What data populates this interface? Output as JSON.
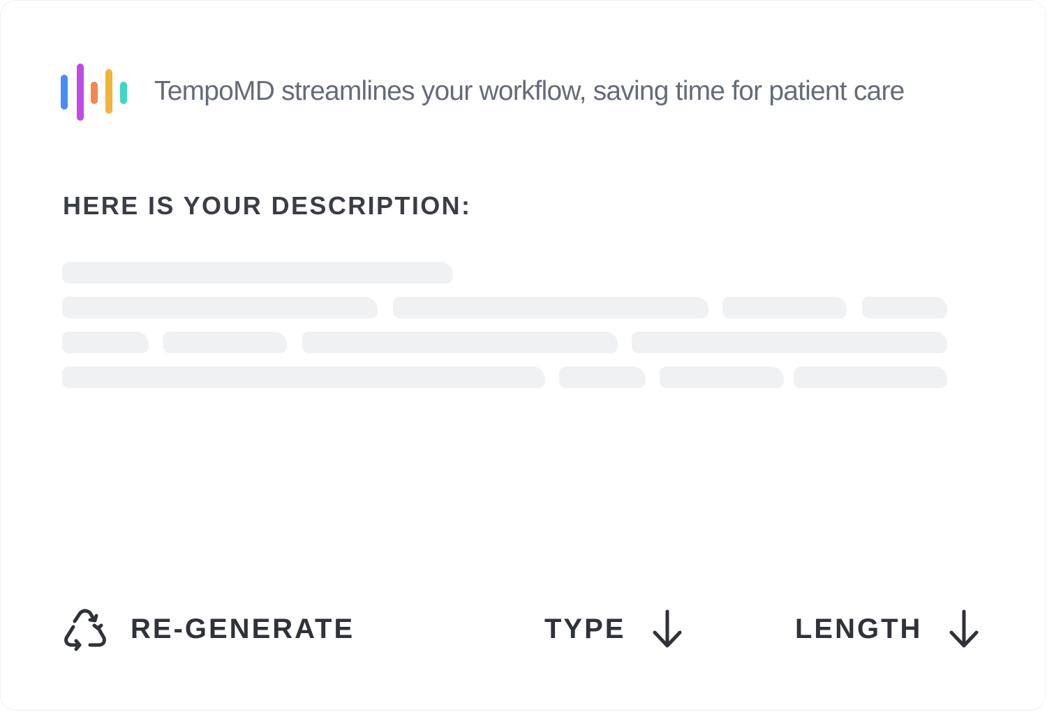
{
  "header": {
    "logo_icon": "sound-wave-logo-icon",
    "logo_colors": [
      "#4a8cf2",
      "#c04ce6",
      "#ef8a4c",
      "#f2b43a",
      "#3ed6c4"
    ],
    "tagline": "TempoMD streamlines your workflow, saving time for patient care"
  },
  "description": {
    "title": "HERE IS YOUR DESCRIPTION:",
    "state": "loading-skeleton"
  },
  "actions": {
    "regenerate": {
      "label": "RE-GENERATE",
      "icon": "recycle-icon"
    },
    "type": {
      "label": "TYPE",
      "icon": "arrow-down-icon"
    },
    "length": {
      "label": "LENGTH",
      "icon": "arrow-down-icon"
    }
  }
}
